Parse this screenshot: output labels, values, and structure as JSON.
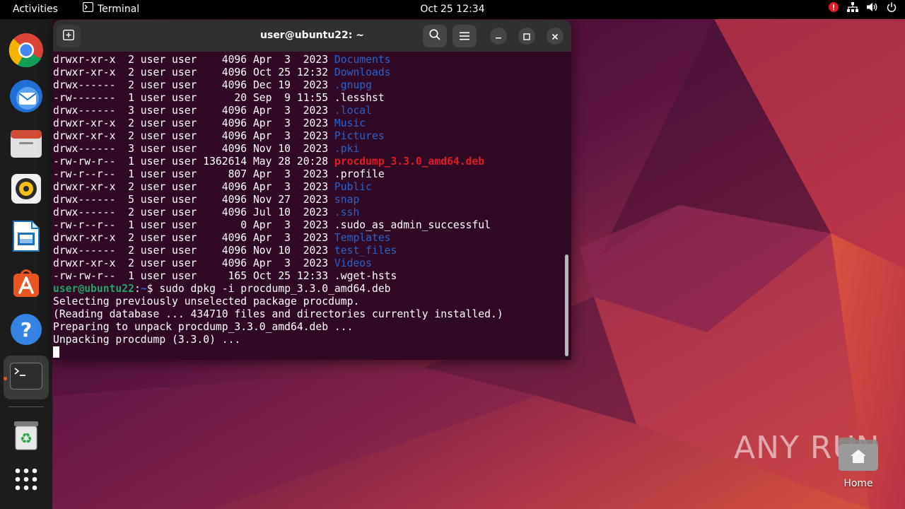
{
  "topbar": {
    "activities": "Activities",
    "app_name": "Terminal",
    "clock": "Oct 25  12:34"
  },
  "dock": {
    "items": [
      "chrome-icon",
      "thunderbird-icon",
      "files-icon",
      "rhythmbox-icon",
      "writer-icon",
      "app-center-icon",
      "help-icon",
      "terminal-icon",
      "trash-icon",
      "show-apps-icon"
    ]
  },
  "terminal": {
    "title": "user@ubuntu22: ~",
    "listing": [
      {
        "perm": "drwxr-xr-x",
        "links": "2",
        "owner": "user",
        "group": "user",
        "size": "4096",
        "date": "Apr  3  2023",
        "name": "Documents",
        "kind": "dir"
      },
      {
        "perm": "drwxr-xr-x",
        "links": "2",
        "owner": "user",
        "group": "user",
        "size": "4096",
        "date": "Oct 25 12:32",
        "name": "Downloads",
        "kind": "dir"
      },
      {
        "perm": "drwx------",
        "links": "2",
        "owner": "user",
        "group": "user",
        "size": "4096",
        "date": "Dec 19  2023",
        "name": ".gnupg",
        "kind": "dir"
      },
      {
        "perm": "-rw-------",
        "links": "1",
        "owner": "user",
        "group": "user",
        "size": "20",
        "date": "Sep  9 11:55",
        "name": ".lesshst",
        "kind": "file"
      },
      {
        "perm": "drwx------",
        "links": "3",
        "owner": "user",
        "group": "user",
        "size": "4096",
        "date": "Apr  3  2023",
        "name": ".local",
        "kind": "dir"
      },
      {
        "perm": "drwxr-xr-x",
        "links": "2",
        "owner": "user",
        "group": "user",
        "size": "4096",
        "date": "Apr  3  2023",
        "name": "Music",
        "kind": "dir"
      },
      {
        "perm": "drwxr-xr-x",
        "links": "2",
        "owner": "user",
        "group": "user",
        "size": "4096",
        "date": "Apr  3  2023",
        "name": "Pictures",
        "kind": "dir"
      },
      {
        "perm": "drwx------",
        "links": "3",
        "owner": "user",
        "group": "user",
        "size": "4096",
        "date": "Nov 10  2023",
        "name": ".pki",
        "kind": "dir"
      },
      {
        "perm": "-rw-rw-r--",
        "links": "1",
        "owner": "user",
        "group": "user",
        "size": "1362614",
        "date": "May 28 20:28",
        "name": "procdump_3.3.0_amd64.deb",
        "kind": "deb"
      },
      {
        "perm": "-rw-r--r--",
        "links": "1",
        "owner": "user",
        "group": "user",
        "size": "807",
        "date": "Apr  3  2023",
        "name": ".profile",
        "kind": "file"
      },
      {
        "perm": "drwxr-xr-x",
        "links": "2",
        "owner": "user",
        "group": "user",
        "size": "4096",
        "date": "Apr  3  2023",
        "name": "Public",
        "kind": "dir"
      },
      {
        "perm": "drwx------",
        "links": "5",
        "owner": "user",
        "group": "user",
        "size": "4096",
        "date": "Nov 27  2023",
        "name": "snap",
        "kind": "dir"
      },
      {
        "perm": "drwx------",
        "links": "2",
        "owner": "user",
        "group": "user",
        "size": "4096",
        "date": "Jul 10  2023",
        "name": ".ssh",
        "kind": "dir"
      },
      {
        "perm": "-rw-r--r--",
        "links": "1",
        "owner": "user",
        "group": "user",
        "size": "0",
        "date": "Apr  3  2023",
        "name": ".sudo_as_admin_successful",
        "kind": "file"
      },
      {
        "perm": "drwxr-xr-x",
        "links": "2",
        "owner": "user",
        "group": "user",
        "size": "4096",
        "date": "Apr  3  2023",
        "name": "Templates",
        "kind": "dir"
      },
      {
        "perm": "drwx------",
        "links": "2",
        "owner": "user",
        "group": "user",
        "size": "4096",
        "date": "Nov 10  2023",
        "name": "test_files",
        "kind": "dir"
      },
      {
        "perm": "drwxr-xr-x",
        "links": "2",
        "owner": "user",
        "group": "user",
        "size": "4096",
        "date": "Apr  3  2023",
        "name": "Videos",
        "kind": "dir"
      },
      {
        "perm": "-rw-rw-r--",
        "links": "1",
        "owner": "user",
        "group": "user",
        "size": "165",
        "date": "Oct 25 12:33",
        "name": ".wget-hsts",
        "kind": "file"
      }
    ],
    "prompt_user": "user@ubuntu22",
    "prompt_path": "~",
    "command": "sudo dpkg -i procdump_3.3.0_amd64.deb",
    "output": [
      "Selecting previously unselected package procdump.",
      "(Reading database ... 434710 files and directories currently installed.)",
      "Preparing to unpack procdump_3.3.0_amd64.deb ...",
      "Unpacking procdump (3.3.0) ..."
    ]
  },
  "desktop": {
    "home_label": "Home",
    "watermark": "ANY RUN"
  },
  "colors": {
    "terminal_bg": "#300a24",
    "dir": "#2a62c9",
    "deb": "#e01b24",
    "prompt": "#26a269",
    "accent": "#e95420"
  }
}
